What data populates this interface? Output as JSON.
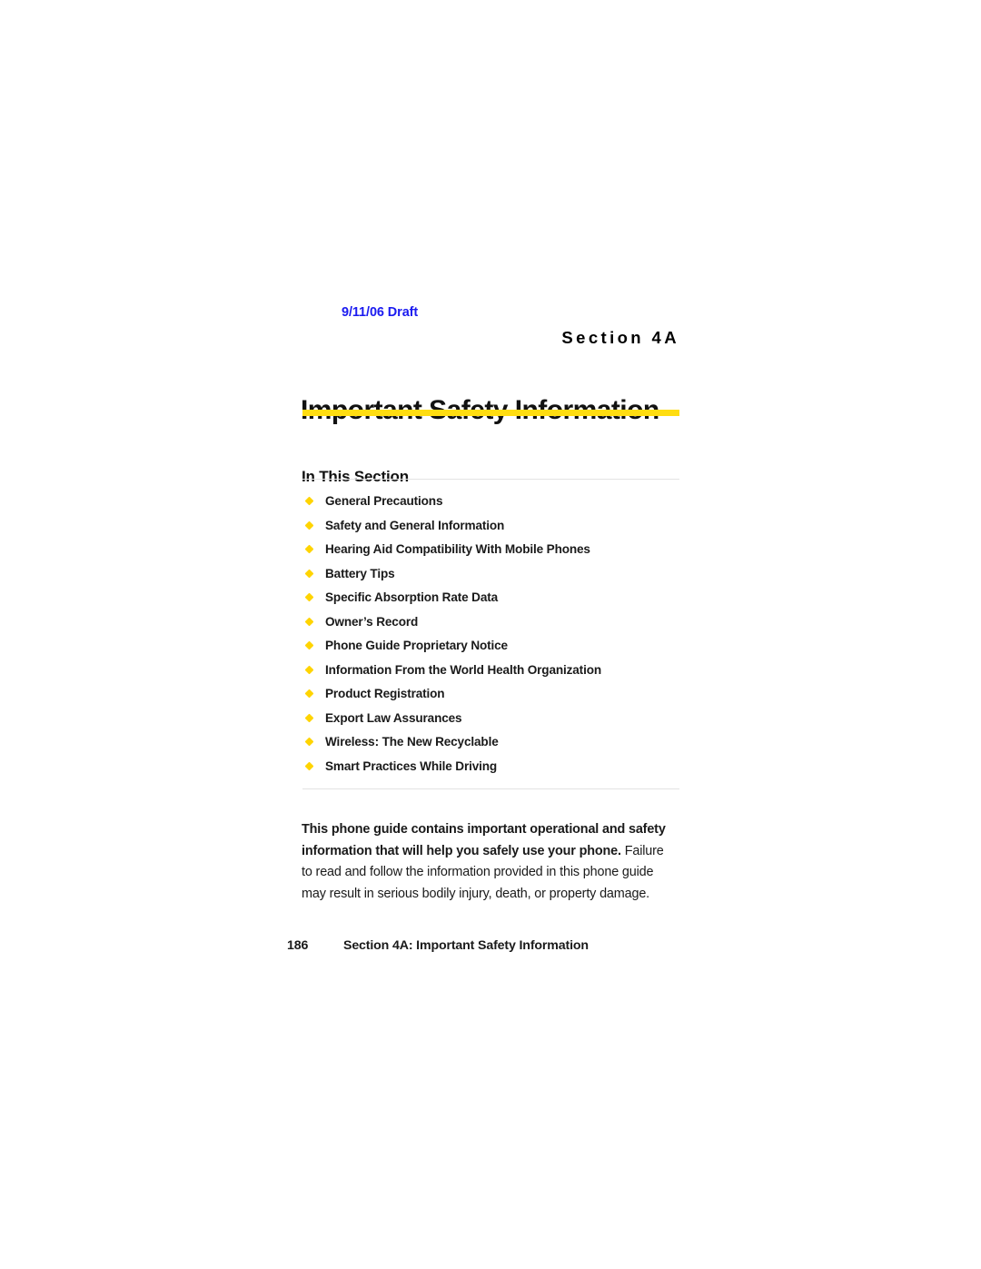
{
  "page": {
    "draft_stamp": "9/11/06 Draft",
    "section_label": "Section 4A",
    "chapter_title": "Important Safety Information",
    "accent_color": "#ffdd11",
    "bullet_color": "#ffd400",
    "draft_color": "#1b1bf0",
    "rule_color": "#e3e3e3"
  },
  "in_this_section": {
    "heading": "In This Section",
    "items": [
      {
        "label": "General Precautions"
      },
      {
        "label": "Safety and General Information"
      },
      {
        "label": "Hearing Aid Compatibility With Mobile Phones"
      },
      {
        "label": "Battery Tips"
      },
      {
        "label": "Specific Absorption Rate Data"
      },
      {
        "label": "Owner’s Record"
      },
      {
        "label": "Phone Guide Proprietary Notice"
      },
      {
        "label": "Information From the World Health Organization"
      },
      {
        "label": "Product Registration"
      },
      {
        "label": "Export Law Assurances"
      },
      {
        "label": "Wireless: The New Recyclable"
      },
      {
        "label": "Smart Practices While Driving"
      }
    ]
  },
  "intro": {
    "lead": "This phone guide contains important operational and safety information that will help you safely use your phone.",
    "rest": " Failure to read and follow the information provided in this phone guide may result in serious bodily injury, death, or property damage."
  },
  "footer": {
    "page_number": "186",
    "caption": "Section 4A: Important Safety Information"
  }
}
